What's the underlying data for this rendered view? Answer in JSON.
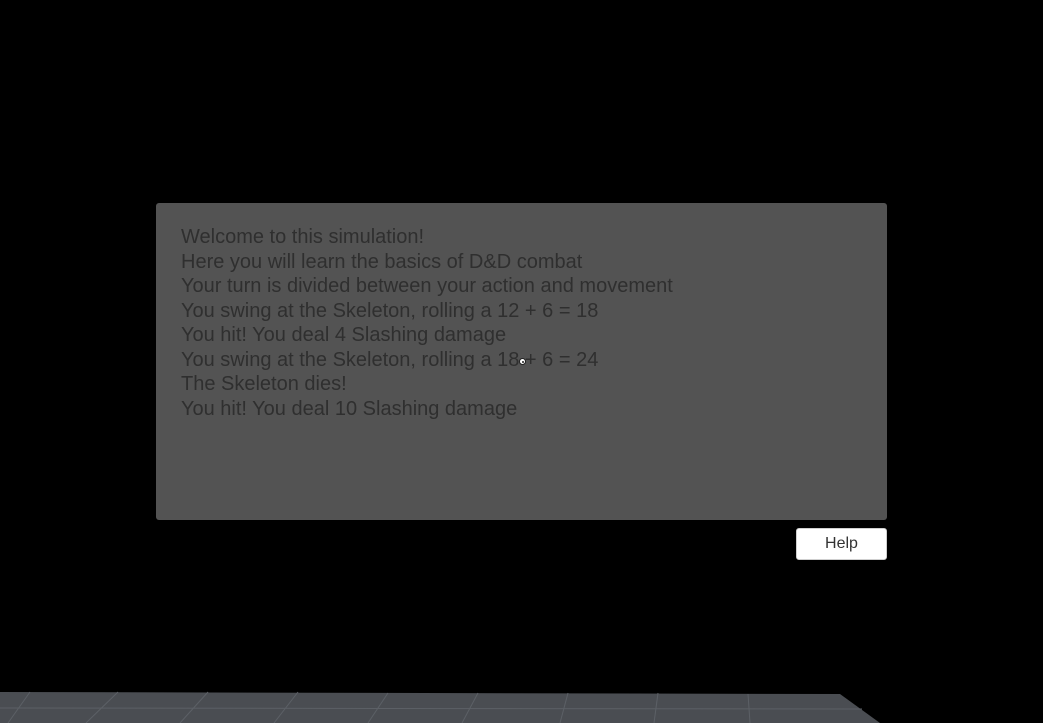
{
  "combat_log": {
    "lines": [
      "Welcome to this simulation!",
      "Here you will learn the basics of D&D combat",
      "Your turn is divided between your action and movement",
      "You swing at the Skeleton, rolling a 12 + 6 = 18",
      "You hit! You deal 4 Slashing damage",
      "You swing at the Skeleton, rolling a 18 + 6 = 24",
      "The Skeleton dies!",
      "You hit! You deal 10 Slashing damage"
    ]
  },
  "help_button": {
    "label": "Help"
  },
  "icons": {
    "cursor": "crosshair-cursor-icon"
  },
  "colors": {
    "background": "#000000",
    "panel": "#535353",
    "panel_text": "#2f2f2f",
    "button": "#ffffff",
    "floor": "#4a4d52",
    "floor_grid": "#5c6066"
  }
}
